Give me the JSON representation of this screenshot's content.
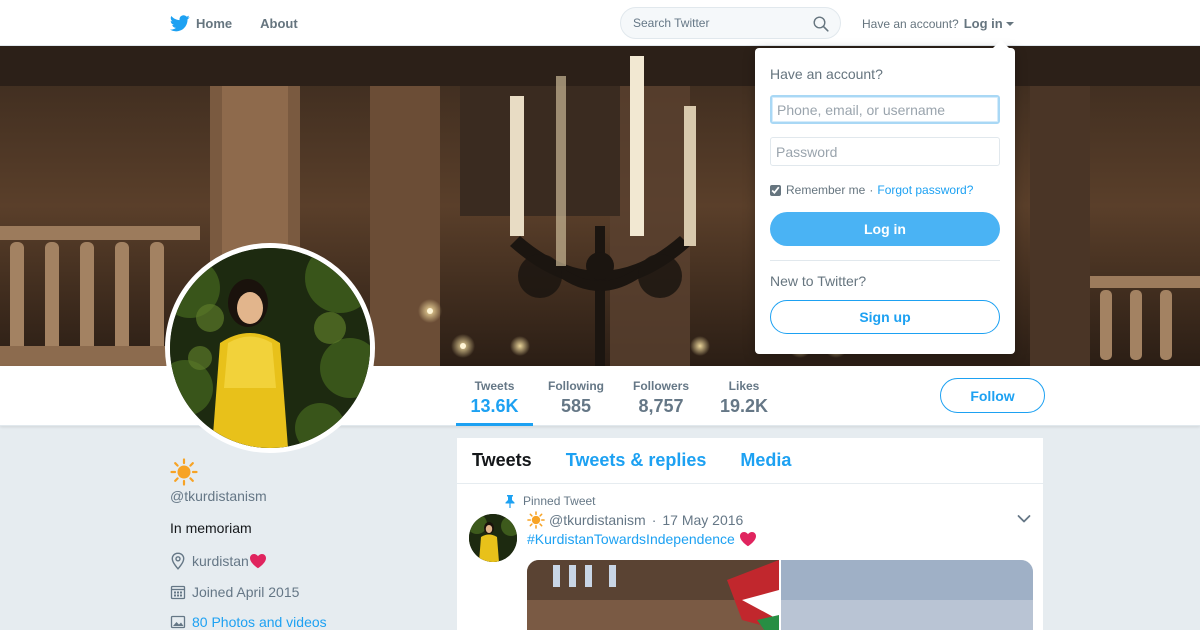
{
  "topbar": {
    "home_label": "Home",
    "about_label": "About",
    "search_placeholder": "Search Twitter",
    "have_account": "Have an account?",
    "login_label": "Log in"
  },
  "profile": {
    "display_name_icon": "sun-emoji-icon",
    "handle": "@tkurdistanism",
    "bio": "In memoriam",
    "location": "kurdistan",
    "joined": "Joined April 2015",
    "photos": "80 Photos and videos"
  },
  "stats": [
    {
      "label": "Tweets",
      "value": "13.6K",
      "active": true
    },
    {
      "label": "Following",
      "value": "585",
      "active": false
    },
    {
      "label": "Followers",
      "value": "8,757",
      "active": false
    },
    {
      "label": "Likes",
      "value": "19.2K",
      "active": false
    }
  ],
  "follow_label": "Follow",
  "timeline": {
    "tabs": [
      {
        "label": "Tweets",
        "active": true
      },
      {
        "label": "Tweets & replies",
        "active": false
      },
      {
        "label": "Media",
        "active": false
      }
    ],
    "pinned_tweet": {
      "pinned_label": "Pinned Tweet",
      "handle": "@tkurdistanism",
      "date": "17 May 2016",
      "hashtag": "#KurdistanTowardsIndependence"
    }
  },
  "login_dropdown": {
    "title": "Have an account?",
    "username_placeholder": "Phone, email, or username",
    "password_placeholder": "Password",
    "remember_me": "Remember me",
    "separator": "·",
    "forgot": "Forgot password?",
    "login_button": "Log in",
    "new_prompt": "New to Twitter?",
    "signup_button": "Sign up"
  },
  "colors": {
    "accent": "#1da1f2",
    "login_button": "#4ab3f4",
    "heart": "#e0245e",
    "sun": "#f7a325"
  }
}
